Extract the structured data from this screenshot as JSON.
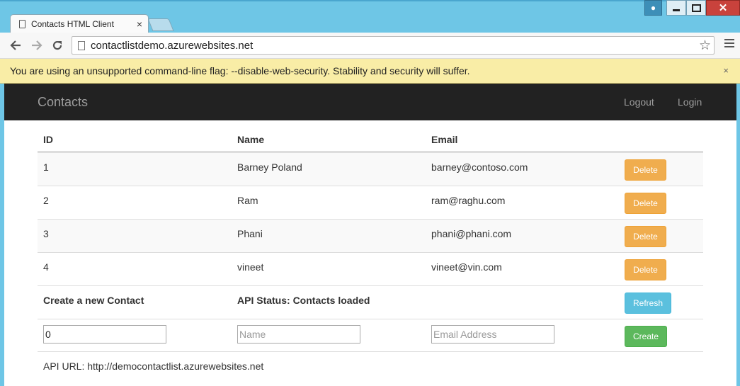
{
  "browser": {
    "tab_title": "Contacts HTML Client",
    "tab_close": "×",
    "url": "contactlistdemo.azurewebsites.net",
    "infobar_message": "You are using an unsupported command-line flag: --disable-web-security. Stability and security will suffer.",
    "infobar_close": "×",
    "icons": {
      "back": "arrow-left-icon",
      "forward": "arrow-right-icon",
      "reload": "reload-icon",
      "bookmark": "star-icon",
      "menu": "hamburger-menu-icon"
    }
  },
  "navbar": {
    "brand": "Contacts",
    "logout": "Logout",
    "login": "Login"
  },
  "table": {
    "headers": [
      "ID",
      "Name",
      "Email"
    ],
    "rows": [
      {
        "id": "1",
        "name": "Barney Poland",
        "email": "barney@contoso.com",
        "action": "Delete"
      },
      {
        "id": "2",
        "name": "Ram",
        "email": "ram@raghu.com",
        "action": "Delete"
      },
      {
        "id": "3",
        "name": "Phani",
        "email": "phani@phani.com",
        "action": "Delete"
      },
      {
        "id": "4",
        "name": "vineet",
        "email": "vineet@vin.com",
        "action": "Delete"
      }
    ]
  },
  "create": {
    "title": "Create a new Contact",
    "status": "API Status: Contacts loaded",
    "refresh": "Refresh",
    "id_value": "0",
    "name_placeholder": "Name",
    "email_placeholder": "Email Address",
    "create_label": "Create"
  },
  "footer": {
    "api_url": "API URL: http://democontactlist.azurewebsites.net"
  },
  "colors": {
    "delete": "#f0ad4e",
    "refresh": "#5bc0de",
    "create": "#5cb85c",
    "navbar": "#222222"
  }
}
